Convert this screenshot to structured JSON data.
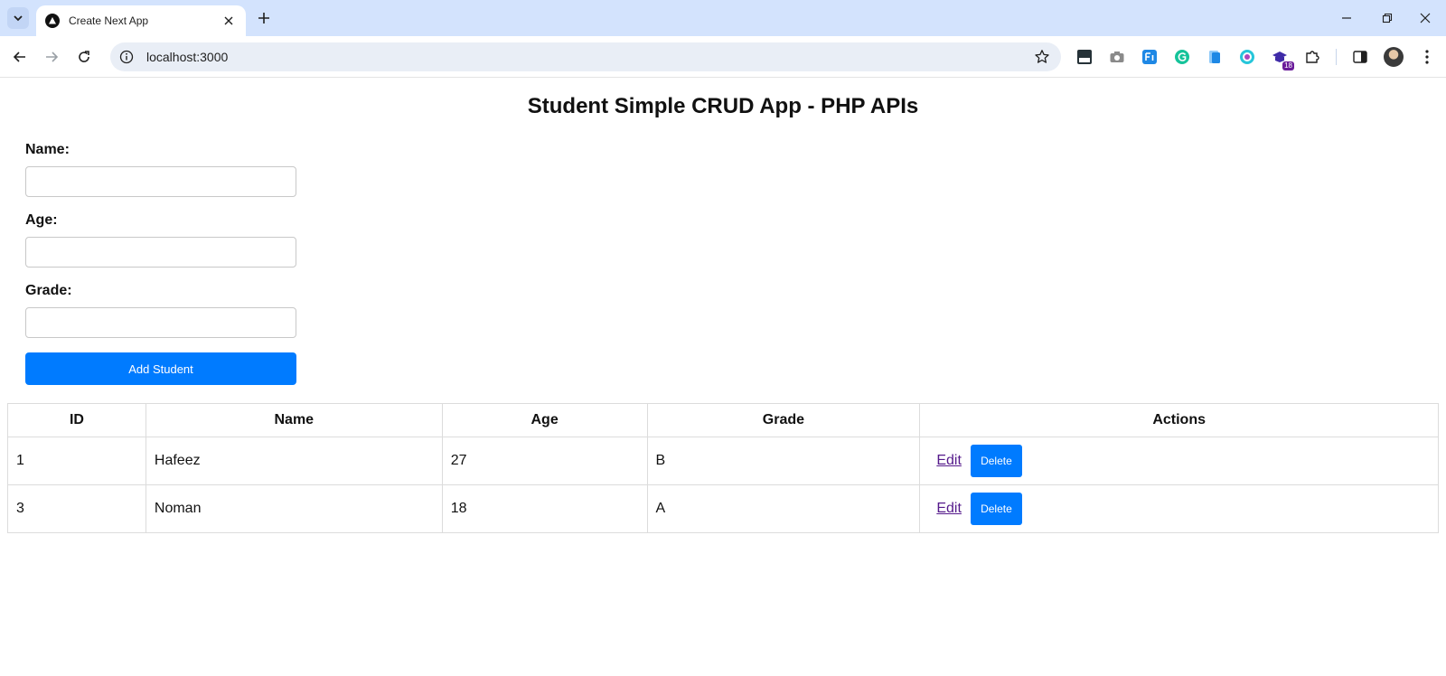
{
  "browser": {
    "tab_title": "Create Next App",
    "url": "localhost:3000",
    "extension_badge": "18"
  },
  "page": {
    "title": "Student Simple CRUD App - PHP APIs"
  },
  "form": {
    "name_label": "Name:",
    "age_label": "Age:",
    "grade_label": "Grade:",
    "name_value": "",
    "age_value": "",
    "grade_value": "",
    "submit_label": "Add Student"
  },
  "table": {
    "headers": [
      "ID",
      "Name",
      "Age",
      "Grade",
      "Actions"
    ],
    "rows": [
      {
        "id": "1",
        "name": "Hafeez",
        "age": "27",
        "grade": "B",
        "edit": "Edit",
        "delete": "Delete"
      },
      {
        "id": "3",
        "name": "Noman",
        "age": "18",
        "grade": "A",
        "edit": "Edit",
        "delete": "Delete"
      }
    ]
  },
  "colors": {
    "primary": "#007bff",
    "tabstrip": "#d3e3fd",
    "visited_link": "#551a8b"
  }
}
